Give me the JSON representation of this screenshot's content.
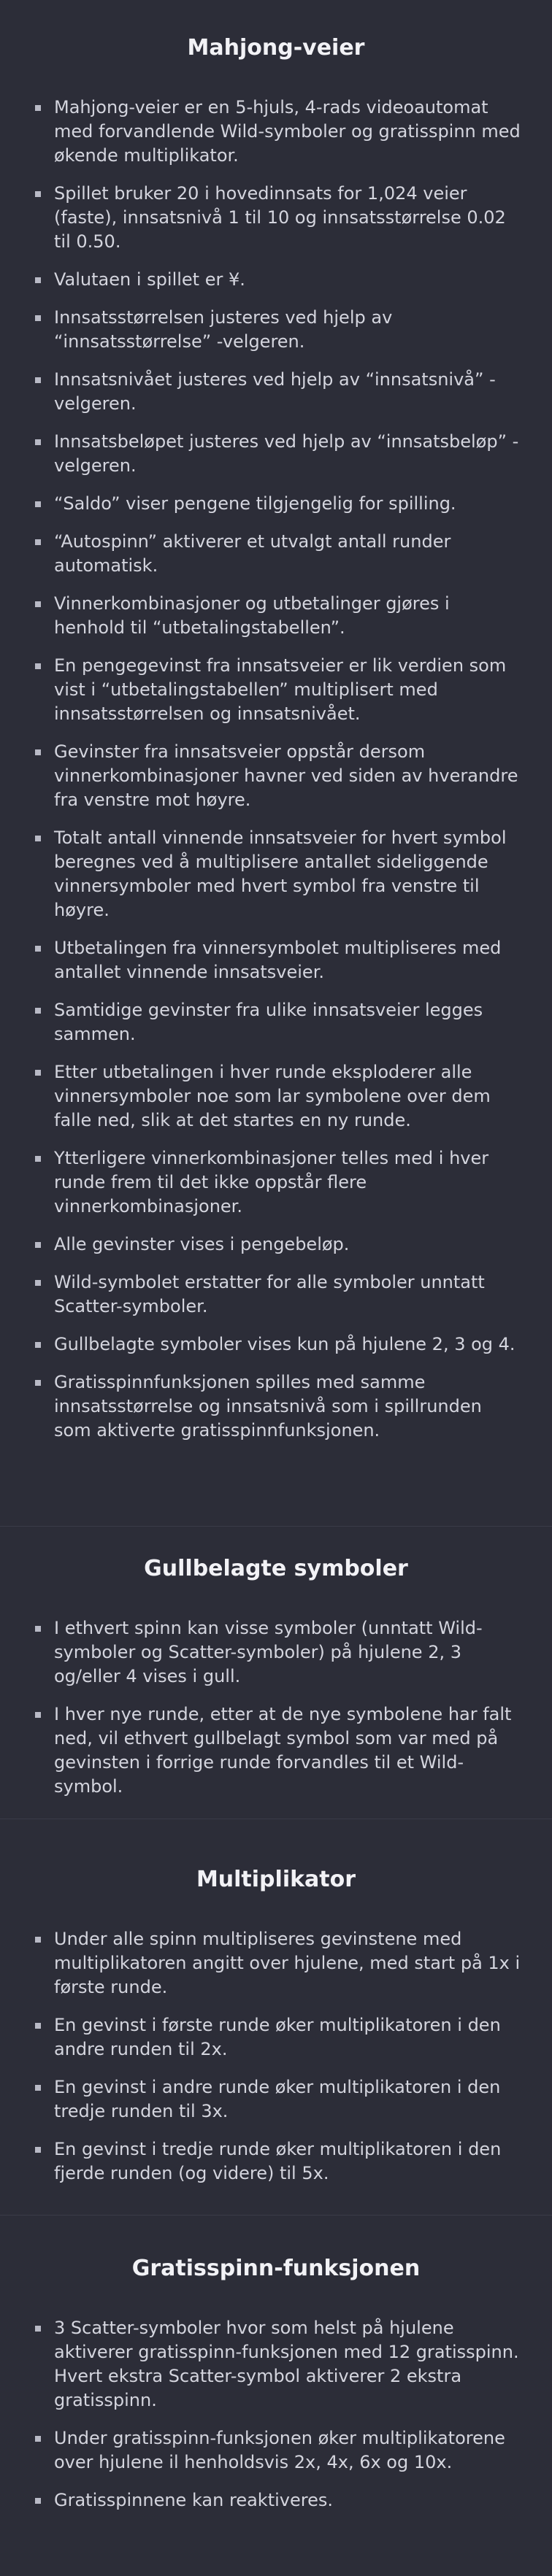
{
  "sections": [
    {
      "title": "Mahjong-veier",
      "items": [
        "Mahjong-veier er en 5-hjuls, 4-rads videoautomat med forvandlende Wild-symboler og gratisspinn med økende multiplikator.",
        "Spillet bruker 20 i hovedinnsats for 1,024 veier (faste), innsatsnivå 1 til 10 og innsatsstørrelse 0.02 til 0.50.",
        "Valutaen i spillet er ¥.",
        "Innsatsstørrelsen justeres ved hjelp av “innsatsstørrelse” -velgeren.",
        "Innsatsnivået justeres ved hjelp av “innsatsnivå” -velgeren.",
        "Innsatsbeløpet justeres ved hjelp av “innsatsbeløp” -velgeren.",
        "“Saldo” viser pengene tilgjengelig for spilling.",
        "“Autospinn” aktiverer et utvalgt antall runder automatisk.",
        "Vinnerkombinasjoner og utbetalinger gjøres i henhold til “utbetalingstabellen”.",
        "En pengegevinst fra innsatsveier er lik verdien som vist i “utbetalingstabellen” multiplisert med innsatsstørrelsen og innsatsnivået.",
        "Gevinster fra innsatsveier oppstår dersom vinnerkombinasjoner havner ved siden av hverandre fra venstre mot høyre.",
        "Totalt antall vinnende innsatsveier for hvert symbol beregnes ved å multiplisere antallet sideliggende vinnersymboler med hvert symbol fra venstre til høyre.",
        "Utbetalingen fra vinnersymbolet multipliseres med antallet vinnende innsatsveier.",
        "Samtidige gevinster fra ulike innsatsveier legges sammen.",
        "Etter utbetalingen i hver runde eksploderer alle vinnersymboler noe som lar symbolene over dem falle ned, slik at det startes en ny runde.",
        "Ytterligere vinnerkombinasjoner telles med i hver runde frem til det ikke oppstår flere vinnerkombinasjoner.",
        "Alle gevinster vises i pengebeløp.",
        "Wild-symbolet erstatter for alle symboler unntatt Scatter-symboler.",
        "Gullbelagte symboler vises kun på hjulene 2, 3 og 4.",
        "Gratisspinnfunksjonen spilles med samme innsatsstørrelse og innsatsnivå som i spillrunden som aktiverte gratisspinnfunksjonen."
      ]
    },
    {
      "title": "Gullbelagte symboler",
      "items": [
        "I ethvert spinn kan visse symboler (unntatt Wild-symboler og Scatter-symboler) på hjulene 2, 3 og/eller 4 vises i gull.",
        "I hver nye runde, etter at de nye symbolene har falt ned, vil ethvert gullbelagt symbol som var med på gevinsten i forrige runde forvandles til et Wild-symbol."
      ]
    },
    {
      "title": "Multiplikator",
      "items": [
        "Under alle spinn multipliseres gevinstene med multiplikatoren angitt over hjulene, med start på 1x i første runde.",
        "En gevinst i første runde øker multiplikatoren i den andre runden til 2x.",
        "En gevinst i andre runde øker multiplikatoren i den tredje runden til 3x.",
        "En gevinst i tredje runde øker multiplikatoren i den fjerde runden (og videre) til 5x."
      ]
    },
    {
      "title": "Gratisspinn-funksjonen",
      "items": [
        "3 Scatter-symboler hvor som helst på hjulene aktiverer gratisspinn-funksjonen med 12 gratisspinn. Hvert ekstra Scatter-symbol aktiverer 2 ekstra gratisspinn.",
        "Under gratisspinn-funksjonen øker multiplikatorene over hjulene il henholdsvis 2x, 4x, 6x og 10x.",
        "Gratisspinnene kan reaktiveres."
      ]
    }
  ],
  "colors": {
    "background": "#2c2d38",
    "title": "#f2f2f6",
    "text": "#d4d5de",
    "bullet": "#b9bac6",
    "divider": "#3a3b48"
  }
}
